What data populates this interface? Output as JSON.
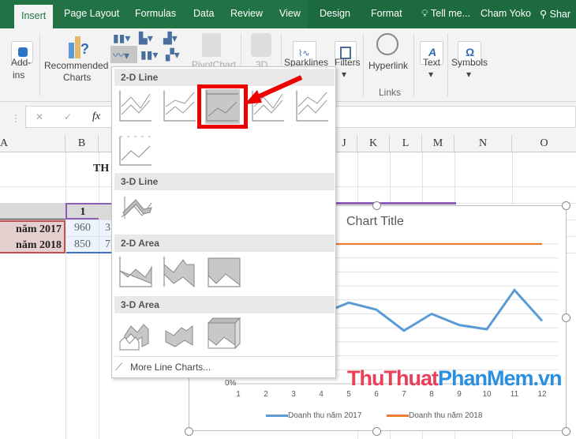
{
  "tabs": [
    {
      "label": "Insert",
      "active": true
    },
    {
      "label": "Page Layout"
    },
    {
      "label": "Formulas"
    },
    {
      "label": "Data"
    },
    {
      "label": "Review"
    },
    {
      "label": "View"
    },
    {
      "label": "Design"
    },
    {
      "label": "Format"
    }
  ],
  "tell_me": "Tell me...",
  "user": "Cham Yoko",
  "share": "Shar",
  "ribbon": {
    "addins": "Add-",
    "addins2": "ins",
    "recommended": "Recommended",
    "recommended2": "Charts",
    "pivotchart": "PivotChart",
    "three_d": "3D",
    "sparklines": "Sparklines",
    "filters": "Filters",
    "hyperlink": "Hyperlink",
    "links_group": "Links",
    "text": "Text",
    "symbols": "Symbols"
  },
  "formula_bar": {
    "cancel": "✕",
    "enter": "✓",
    "fx": "fx",
    "value": ""
  },
  "columns": [
    "A",
    "B",
    "J",
    "K",
    "L",
    "M",
    "N",
    "O"
  ],
  "sheet": {
    "title_fragment": "TH",
    "header_col1": "1",
    "row1_label": "năm 2017",
    "row1_b": "960",
    "row1_c": "3",
    "row2_label": "năm 2018",
    "row2_b": "850",
    "row2_c": "7"
  },
  "menu": {
    "section_2d_line": "2-D Line",
    "section_3d_line": "3-D Line",
    "section_2d_area": "2-D Area",
    "section_3d_area": "3-D Area",
    "more": "More Line Charts..."
  },
  "chart_data": {
    "type": "line",
    "title": "Chart Title",
    "categories": [
      "1",
      "2",
      "3",
      "4",
      "5",
      "6",
      "7",
      "8",
      "9",
      "10",
      "11",
      "12"
    ],
    "ylim": [
      0,
      100
    ],
    "y_tick_visible": "0%",
    "series": [
      {
        "name": "Doanh thu năm 2017",
        "color": "#5b9bd5",
        "values": [
          55,
          45,
          52,
          50,
          58,
          53,
          38,
          50,
          42,
          39,
          67,
          45
        ]
      },
      {
        "name": "Doanh thu năm 2018",
        "color": "#ed7d31",
        "values": [
          100,
          100,
          100,
          100,
          100,
          100,
          100,
          100,
          100,
          100,
          100,
          100
        ]
      }
    ]
  },
  "watermark": {
    "part1": "ThuThuat",
    "part2": "PhanMem",
    "part3": ".vn"
  }
}
